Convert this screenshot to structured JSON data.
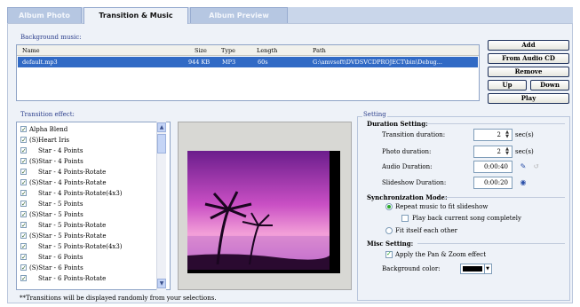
{
  "tabs": [
    {
      "label": "Album Photo"
    },
    {
      "label": "Transition & Music"
    },
    {
      "label": "Album Preview"
    }
  ],
  "background_music": {
    "label": "Background music:",
    "columns": [
      "Name",
      "Size",
      "Type",
      "Length",
      "Path"
    ],
    "rows": [
      {
        "name": "default.mp3",
        "size": "944 KB",
        "type": "MP3",
        "length": "60s",
        "path": "G:\\amvsoft\\DVDSVCDPROJECT\\bin\\Debug..."
      }
    ],
    "buttons": {
      "add": "Add",
      "from_cd": "From Audio CD",
      "remove": "Remove",
      "up": "Up",
      "down": "Down",
      "play": "Play"
    }
  },
  "transition": {
    "label": "Transition effect:",
    "items": [
      "Alpha Blend",
      "(S)Heart Iris",
      "Star - 4 Points",
      "(S)Star - 4 Points",
      "Star - 4 Points-Rotate",
      "(S)Star - 4 Points-Rotate",
      "Star - 4 Points-Rotate(4x3)",
      "Star - 5 Points",
      "(S)Star - 5 Points",
      "Star - 5 Points-Rotate",
      "(S)Star - 5 Points-Rotate",
      "Star - 5 Points-Rotate(4x3)",
      "Star - 6 Points",
      "(S)Star - 6 Points",
      "Star - 6 Points-Rotate"
    ],
    "note": "**Transitions will be displayed randomly from your selections."
  },
  "setting": {
    "label": "Setting",
    "duration": {
      "label": "Duration Setting:",
      "transition_label": "Transition duration:",
      "transition_value": "2",
      "photo_label": "Photo duration:",
      "photo_value": "2",
      "unit": "sec(s)",
      "audio_label": "Audio Duration:",
      "audio_value": "0:00:40",
      "slideshow_label": "Slideshow Duration:",
      "slideshow_value": "0:00:20"
    },
    "sync": {
      "label": "Synchronization Mode:",
      "repeat": "Repeat music to fit slideshow",
      "playback": "Play back current song completely",
      "fit": "Fit itself each other"
    },
    "misc": {
      "label": "Misc Setting:",
      "panzoom": "Apply the Pan & Zoom effect",
      "bgcolor_label": "Background color:",
      "bgcolor_value": "#000000"
    }
  }
}
